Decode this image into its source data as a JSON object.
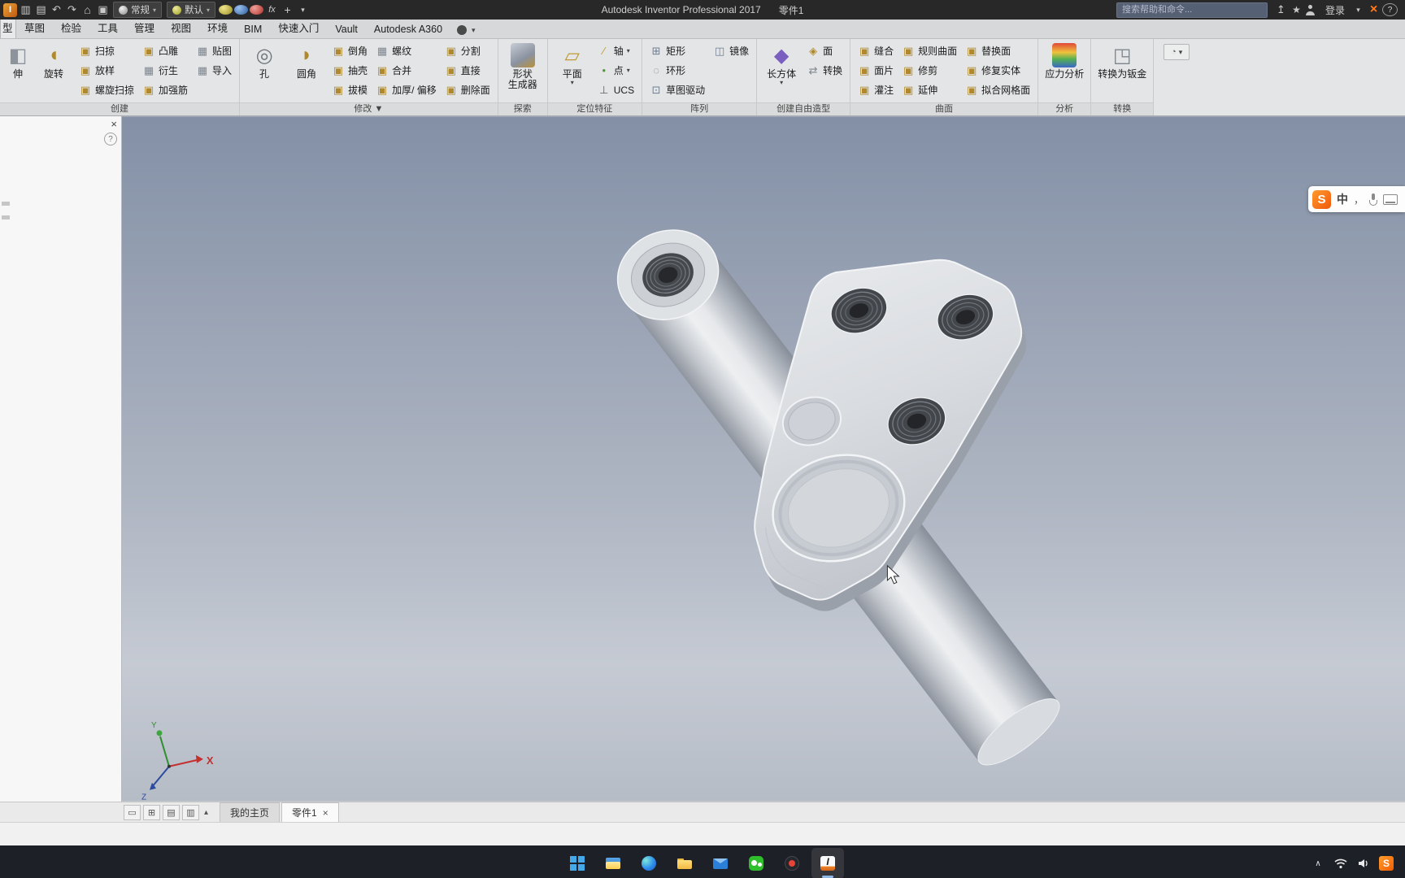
{
  "titlebar": {
    "app_title": "Autodesk Inventor Professional 2017",
    "doc_title": "零件1",
    "quick_access": [
      "app-menu",
      "open",
      "save",
      "undo",
      "redo",
      "home",
      "clipboard"
    ],
    "material_combo": "常规",
    "appearance_combo": "默认",
    "extra_tools": [
      "sphere-gold",
      "sphere-blue",
      "sphere-red",
      "fx",
      "measure-plus",
      "customize-caret"
    ],
    "search_placeholder": "搜索帮助和命令...",
    "right_icons": [
      "send-up",
      "favorites-star",
      "user"
    ],
    "sign_in_label": "登录",
    "far_right_icons": [
      "caret-down",
      "x-logo",
      "help"
    ]
  },
  "ribbon_tabs": [
    "型",
    "草图",
    "检验",
    "工具",
    "管理",
    "视图",
    "环境",
    "BIM",
    "快速入门",
    "Vault",
    "Autodesk A360"
  ],
  "ribbon": {
    "toggle_glyph": "▾",
    "groups": [
      {
        "id": "create",
        "label": "创建",
        "bigs": [
          {
            "name": "extrude",
            "label": "伸",
            "icon": "extrude",
            "cut": true
          },
          {
            "name": "revolve",
            "label": "旋转",
            "icon": "revolve"
          }
        ],
        "cols": [
          [
            {
              "name": "sweep",
              "label": "扫掠",
              "icon": "gold"
            },
            {
              "name": "loft",
              "label": "放样",
              "icon": "gold"
            },
            {
              "name": "coil",
              "label": "螺旋扫掠",
              "icon": "gold"
            }
          ],
          [
            {
              "name": "emboss",
              "label": "凸雕",
              "icon": "gold"
            },
            {
              "name": "derive",
              "label": "衍生",
              "icon": "gray"
            },
            {
              "name": "rib",
              "label": "加强筋",
              "icon": "gold"
            }
          ],
          [
            {
              "name": "decal",
              "label": "贴图",
              "icon": "gray"
            },
            {
              "name": "import",
              "label": "导入",
              "icon": "gray"
            }
          ]
        ]
      },
      {
        "id": "modify",
        "label": "修改",
        "caret": true,
        "bigs": [
          {
            "name": "hole",
            "label": "孔",
            "icon": "hole"
          },
          {
            "name": "fillet",
            "label": "圆角",
            "icon": "fillet"
          }
        ],
        "cols": [
          [
            {
              "name": "chamfer",
              "label": "倒角",
              "icon": "gold"
            },
            {
              "name": "shell",
              "label": "抽壳",
              "icon": "gold"
            },
            {
              "name": "draft",
              "label": "拔模",
              "icon": "gold"
            }
          ],
          [
            {
              "name": "thread",
              "label": "螺纹",
              "icon": "gray"
            },
            {
              "name": "combine",
              "label": "合并",
              "icon": "gold"
            },
            {
              "name": "thicken-offset",
              "label": "加厚/ 偏移",
              "icon": "gold"
            }
          ],
          [
            {
              "name": "split",
              "label": "分割",
              "icon": "gold"
            },
            {
              "name": "direct-edit",
              "label": "直接",
              "icon": "gold"
            },
            {
              "name": "delete-face",
              "label": "删除面",
              "icon": "gold"
            }
          ]
        ]
      },
      {
        "id": "explore",
        "label": "探索",
        "bigs": [
          {
            "name": "shape-generator",
            "label": "形状\n生成器",
            "icon": "shapegen"
          }
        ]
      },
      {
        "id": "work-features",
        "label": "定位特征",
        "bigs": [
          {
            "name": "plane",
            "label": "平面",
            "icon": "plane",
            "caret": true
          }
        ],
        "cols": [
          [
            {
              "name": "axis",
              "label": "轴",
              "icon": "axis",
              "caret": true
            },
            {
              "name": "point",
              "label": "点",
              "icon": "point",
              "caret": true
            },
            {
              "name": "ucs",
              "label": "UCS",
              "icon": "ucs"
            }
          ]
        ]
      },
      {
        "id": "pattern",
        "label": "阵列",
        "cols": [
          [
            {
              "name": "rectangular-pattern",
              "label": "矩形",
              "icon": "rect"
            },
            {
              "name": "circular-pattern",
              "label": "环形",
              "icon": "ring"
            },
            {
              "name": "sketch-driven-pattern",
              "label": "草图驱动",
              "icon": "sketchdrive"
            }
          ],
          [
            {
              "name": "mirror",
              "label": "镜像",
              "icon": "mirror"
            }
          ]
        ]
      },
      {
        "id": "freeform",
        "label": "创建自由造型",
        "bigs": [
          {
            "name": "freeform-box",
            "label": "长方体",
            "icon": "box",
            "caret": true
          }
        ],
        "cols": [
          [
            {
              "name": "freeform-face",
              "label": "面",
              "icon": "face"
            },
            {
              "name": "freeform-convert",
              "label": "转换",
              "icon": "convert"
            }
          ]
        ]
      },
      {
        "id": "surface",
        "label": "曲面",
        "cols": [
          [
            {
              "name": "stitch",
              "label": "缝合",
              "icon": "gold"
            },
            {
              "name": "patch",
              "label": "面片",
              "icon": "gold"
            },
            {
              "name": "sculpt",
              "label": "灌注",
              "icon": "gold"
            }
          ],
          [
            {
              "name": "ruled-surface",
              "label": "规则曲面",
              "icon": "gold"
            },
            {
              "name": "trim",
              "label": "修剪",
              "icon": "gold"
            },
            {
              "name": "extend",
              "label": "延伸",
              "icon": "gold"
            }
          ],
          [
            {
              "name": "replace-face",
              "label": "替换面",
              "icon": "gold"
            },
            {
              "name": "repair-bodies",
              "label": "修复实体",
              "icon": "gold"
            },
            {
              "name": "fit-mesh-face",
              "label": "拟合网格面",
              "icon": "gold"
            }
          ]
        ]
      },
      {
        "id": "simulation",
        "label": "分析",
        "bigs": [
          {
            "name": "stress-analysis",
            "label": "应力分析",
            "icon": "stress"
          }
        ]
      },
      {
        "id": "convert",
        "label": "转换",
        "bigs": [
          {
            "name": "convert-to-sheet-metal",
            "label": "转换为钣金",
            "icon": "sheetmetal"
          }
        ]
      }
    ]
  },
  "left_panel": {
    "close_glyph": "×",
    "help_glyph": "?"
  },
  "viewport": {
    "ime": {
      "logo": "S",
      "mode": "中",
      "punct": "，"
    },
    "axes": {
      "x": "X",
      "y": "Y",
      "z": "Z"
    }
  },
  "docbar": {
    "window_icons": [
      {
        "name": "cascade",
        "glyph": "▭"
      },
      {
        "name": "tile-grid",
        "glyph": "⊞"
      },
      {
        "name": "tile-horizontal",
        "glyph": "▤"
      },
      {
        "name": "tile-vertical",
        "glyph": "▥"
      }
    ],
    "collapse_glyph": "▴",
    "close_glyph": "×",
    "tabs": [
      {
        "label": "我的主页",
        "active": false,
        "closable": false
      },
      {
        "label": "零件1",
        "active": true,
        "closable": true
      }
    ]
  },
  "taskbar": {
    "icons": [
      "start",
      "explorer",
      "edge",
      "folder",
      "mail",
      "wechat",
      "browser",
      "inventor"
    ],
    "active": "inventor",
    "tray": [
      "chevron-up",
      "wifi",
      "volume",
      "sogou"
    ]
  }
}
